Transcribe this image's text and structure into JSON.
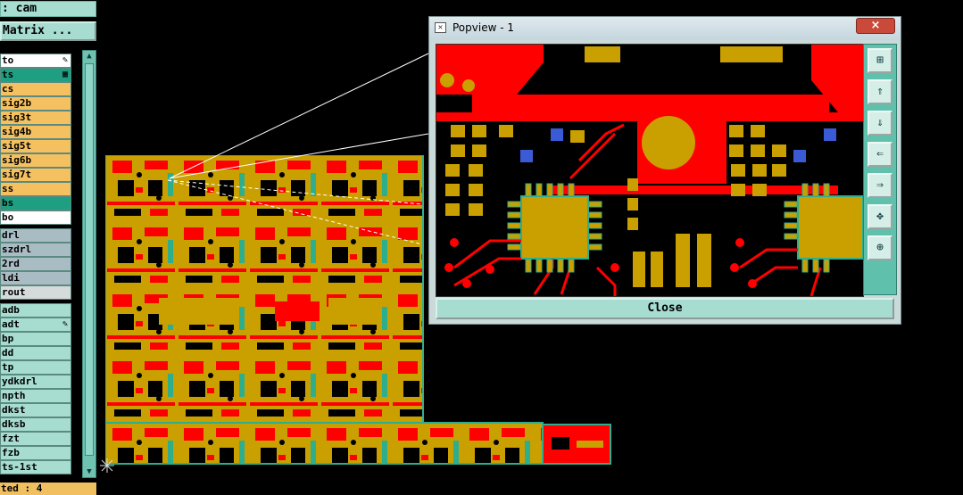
{
  "job": {
    "title": ": cam",
    "matrix_button": "Matrix ..."
  },
  "layers": [
    {
      "name": "to",
      "bg": "#ffffff",
      "mark": "✎"
    },
    {
      "name": "ts",
      "bg": "#1f9f82",
      "mark": "▦"
    },
    {
      "name": "cs",
      "bg": "#f5c060"
    },
    {
      "name": "sig2b",
      "bg": "#f5c060"
    },
    {
      "name": "sig3t",
      "bg": "#f5c060"
    },
    {
      "name": "sig4b",
      "bg": "#f5c060"
    },
    {
      "name": "sig5t",
      "bg": "#f5c060"
    },
    {
      "name": "sig6b",
      "bg": "#f5c060"
    },
    {
      "name": "sig7t",
      "bg": "#f5c060"
    },
    {
      "name": "ss",
      "bg": "#f5c060"
    },
    {
      "name": "bs",
      "bg": "#1f9f82"
    },
    {
      "name": "bo",
      "bg": "#ffffff"
    },
    {
      "name": "drl",
      "bg": "#a9bcc4"
    },
    {
      "name": "szdrl",
      "bg": "#a9bcc4"
    },
    {
      "name": "2rd",
      "bg": "#a9bcc4"
    },
    {
      "name": "ldi",
      "bg": "#a9bcc4"
    },
    {
      "name": "rout",
      "bg": "#d5dadb"
    },
    {
      "name": "adb",
      "bg": "#a7dcd0"
    },
    {
      "name": "adt",
      "bg": "#a7dcd0",
      "mark": "✎"
    },
    {
      "name": "bp",
      "bg": "#a7dcd0"
    },
    {
      "name": "dd",
      "bg": "#a7dcd0"
    },
    {
      "name": "tp",
      "bg": "#a7dcd0"
    },
    {
      "name": "ydkdrl",
      "bg": "#a7dcd0"
    },
    {
      "name": "npth",
      "bg": "#a7dcd0"
    },
    {
      "name": "dkst",
      "bg": "#a7dcd0"
    },
    {
      "name": "dksb",
      "bg": "#a7dcd0"
    },
    {
      "name": "fzt",
      "bg": "#a7dcd0"
    },
    {
      "name": "fzb",
      "bg": "#a7dcd0"
    },
    {
      "name": "ts-1st",
      "bg": "#a7dcd0"
    }
  ],
  "status": {
    "text": "ted : 4"
  },
  "popview": {
    "title": "Popview - 1",
    "close_x": "×",
    "close_button": "Close",
    "tools": [
      {
        "icon": "zoom-fit-icon",
        "glyph": "⊞"
      },
      {
        "icon": "pan-up-icon",
        "glyph": "⇑"
      },
      {
        "icon": "pan-down-icon",
        "glyph": "⇓"
      },
      {
        "icon": "pan-left-icon",
        "glyph": "⇐"
      },
      {
        "icon": "pan-right-icon",
        "glyph": "⇒"
      },
      {
        "icon": "zoom-in-icon",
        "glyph": "✥"
      },
      {
        "icon": "zoom-out-icon",
        "glyph": "⊕"
      }
    ]
  },
  "colors": {
    "copper": "#c9a000",
    "trace": "#ff0000",
    "mask": "#2fae8e",
    "pad_blue": "#3b5bd6"
  }
}
